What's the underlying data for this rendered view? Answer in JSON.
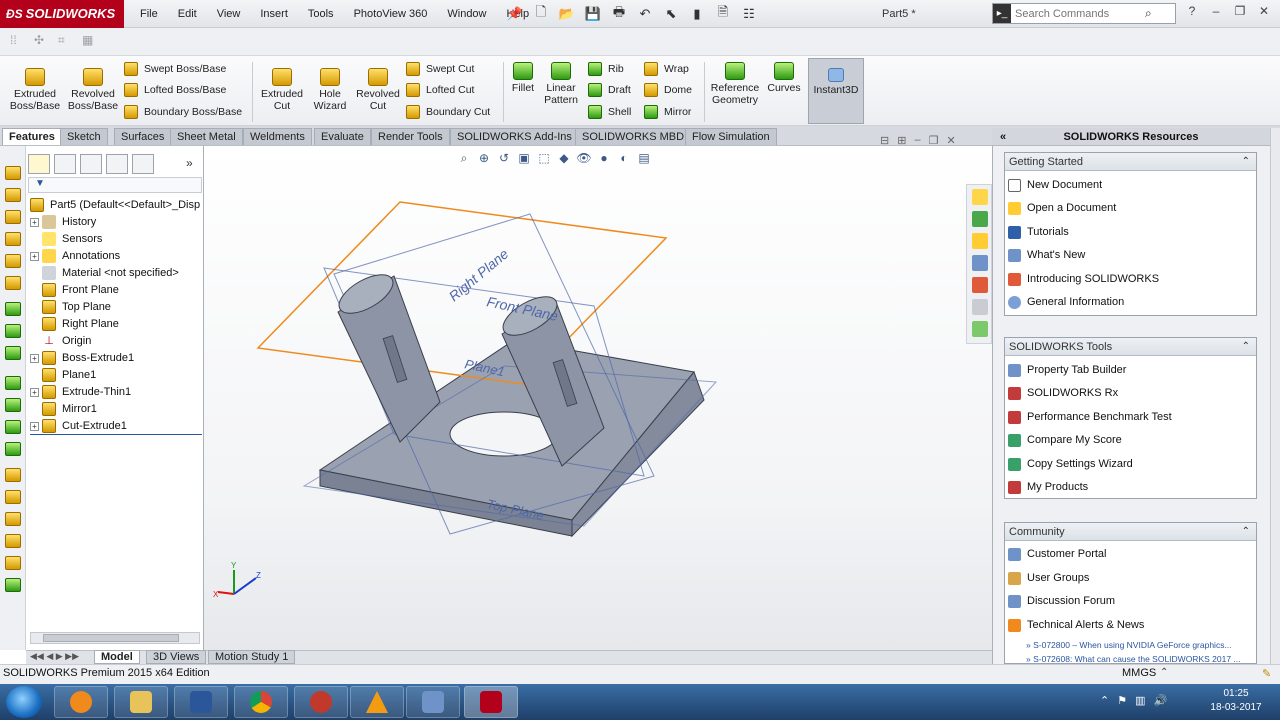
{
  "app": {
    "logo_text": "SOLIDWORKS",
    "doc_title": "Part5 *",
    "edition": "SOLIDWORKS Premium 2015 x64 Edition"
  },
  "menu": [
    "File",
    "Edit",
    "View",
    "Insert",
    "Tools",
    "PhotoView 360",
    "Window",
    "Help"
  ],
  "search": {
    "placeholder": "Search Commands"
  },
  "commands": {
    "extruded_boss": "Extruded Boss/Base",
    "revolved_boss": "Revolved Boss/Base",
    "swept_boss": "Swept Boss/Base",
    "lofted_boss": "Lofted Boss/Base",
    "boundary_boss": "Boundary Boss/Base",
    "extruded_cut": "Extruded Cut",
    "hole_wizard": "Hole Wizard",
    "revolved_cut": "Revolved Cut",
    "swept_cut": "Swept Cut",
    "lofted_cut": "Lofted Cut",
    "boundary_cut": "Boundary Cut",
    "fillet": "Fillet",
    "linear_pattern": "Linear Pattern",
    "rib": "Rib",
    "draft": "Draft",
    "shell": "Shell",
    "wrap": "Wrap",
    "dome": "Dome",
    "mirror": "Mirror",
    "reference_geometry": "Reference Geometry",
    "curves": "Curves",
    "instant3d": "Instant3D"
  },
  "tabs": [
    "Features",
    "Sketch",
    "Surfaces",
    "Sheet Metal",
    "Weldments",
    "Evaluate",
    "Render Tools",
    "SOLIDWORKS Add-Ins",
    "SOLIDWORKS MBD",
    "Flow Simulation"
  ],
  "tree": {
    "root": "Part5  (Default<<Default>_Disp",
    "items": [
      "History",
      "Sensors",
      "Annotations",
      "Material <not specified>",
      "Front Plane",
      "Top Plane",
      "Right Plane",
      "Origin",
      "Boss-Extrude1",
      "Plane1",
      "Extrude-Thin1",
      "Mirror1",
      "Cut-Extrude1"
    ]
  },
  "viewport": {
    "plane_labels": [
      "Right Plane",
      "Front Plane",
      "Plane1",
      "Top Plane"
    ],
    "triad": [
      "X",
      "Y",
      "Z"
    ]
  },
  "model_tabs": [
    "Model",
    "3D Views",
    "Motion Study 1"
  ],
  "status": {
    "units": "MMGS"
  },
  "resources": {
    "title": "SOLIDWORKS Resources",
    "getting_started": {
      "title": "Getting Started",
      "links": [
        "New Document",
        "Open a Document",
        "Tutorials",
        "What's New",
        "Introducing SOLIDWORKS",
        "General Information"
      ]
    },
    "tools": {
      "title": "SOLIDWORKS Tools",
      "links": [
        "Property Tab Builder",
        "SOLIDWORKS Rx",
        "Performance Benchmark Test",
        "Compare My Score",
        "Copy Settings Wizard",
        "My Products"
      ]
    },
    "community": {
      "title": "Community",
      "links": [
        "Customer Portal",
        "User Groups",
        "Discussion Forum",
        "Technical Alerts & News"
      ],
      "news": [
        "S-072800 – When using NVIDIA GeForce graphics...",
        "S-072608: What can cause the SOLIDWORKS 2017 ..."
      ]
    }
  },
  "taskbar": {
    "time": "01:25",
    "date": "18-03-2017"
  }
}
